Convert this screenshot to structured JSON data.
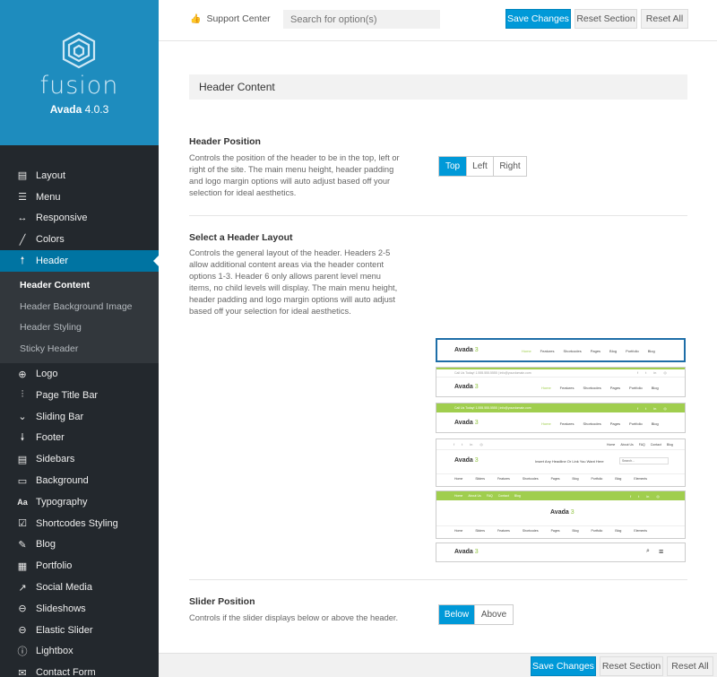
{
  "brand": {
    "logo_text": "fusion",
    "product": "Avada",
    "version": "4.0.3",
    "color": "#1e8cbe"
  },
  "sidebar": {
    "items": [
      {
        "label": "Layout",
        "icon": "layout-icon"
      },
      {
        "label": "Menu",
        "icon": "menu-icon"
      },
      {
        "label": "Responsive",
        "icon": "arrows-horizontal-icon"
      },
      {
        "label": "Colors",
        "icon": "brush-icon"
      },
      {
        "label": "Header",
        "icon": "arrow-up-icon",
        "active": true
      },
      {
        "label": "Logo",
        "icon": "plus-circle-icon"
      },
      {
        "label": "Page Title Bar",
        "icon": "sliders-icon"
      },
      {
        "label": "Sliding Bar",
        "icon": "chevron-down-icon"
      },
      {
        "label": "Footer",
        "icon": "arrow-down-icon"
      },
      {
        "label": "Sidebars",
        "icon": "sidebar-icon"
      },
      {
        "label": "Background",
        "icon": "monitor-icon"
      },
      {
        "label": "Typography",
        "icon": "typography-icon"
      },
      {
        "label": "Shortcodes Styling",
        "icon": "checkbox-icon"
      },
      {
        "label": "Blog",
        "icon": "edit-icon"
      },
      {
        "label": "Portfolio",
        "icon": "grid-icon"
      },
      {
        "label": "Social Media",
        "icon": "share-icon"
      },
      {
        "label": "Slideshows",
        "icon": "minus-circle-icon"
      },
      {
        "label": "Elastic Slider",
        "icon": "minus-circle-icon"
      },
      {
        "label": "Lightbox",
        "icon": "info-icon"
      },
      {
        "label": "Contact Form",
        "icon": "envelope-icon"
      }
    ],
    "subitems": [
      {
        "label": "Header Content",
        "current": true
      },
      {
        "label": "Header Background Image"
      },
      {
        "label": "Header Styling"
      },
      {
        "label": "Sticky Header"
      }
    ]
  },
  "topbar": {
    "support_label": "Support Center",
    "search_placeholder": "Search for option(s)",
    "save_label": "Save Changes",
    "reset_section_label": "Reset Section",
    "reset_all_label": "Reset All"
  },
  "content": {
    "section_title": "Header Content",
    "header_position": {
      "title": "Header Position",
      "desc": "Controls the position of the header to be in the top, left or right of the site. The main menu height, header padding and logo margin options will auto adjust based off your selection for ideal aesthetics.",
      "options": [
        "Top",
        "Left",
        "Right"
      ],
      "selected": "Top"
    },
    "header_layout": {
      "title": "Select a Header Layout",
      "desc": "Controls the general layout of the header. Headers 2-5 allow additional content areas via the header content options 1-3. Header 6 only allows parent level menu items, no child levels will display. The main menu height, header padding and logo margin options will auto adjust based off your selection for ideal aesthetics.",
      "thumb_logo": "Avada",
      "thumb_menu": [
        "Home",
        "Features",
        "Shortcodes",
        "Pages",
        "Blog",
        "Portfolio",
        "Blog"
      ],
      "thumb_menu_long": [
        "Home",
        "Sliders",
        "Features",
        "Shortcodes",
        "Pages",
        "Blog",
        "Portfolio",
        "Blog",
        "Elements"
      ],
      "thumb_contact": "Call Us Today! 1.555.555.5555 | info@yourdomain.com",
      "thumb_headline": "Insert Any Headline Or Link You Want Here",
      "thumb_search": "Search...",
      "thumb_top_links": [
        "Home",
        "About Us",
        "FAQ",
        "Contact",
        "Blog"
      ]
    },
    "slider_position": {
      "title": "Slider Position",
      "desc": "Controls if the slider displays below or above the header.",
      "options": [
        "Below",
        "Above"
      ],
      "selected": "Below"
    }
  },
  "colors": {
    "accent": "#0099d8",
    "sidebar_bg": "#23282d",
    "active_item": "#0074a2",
    "thumb_green": "#a0ce4e"
  }
}
